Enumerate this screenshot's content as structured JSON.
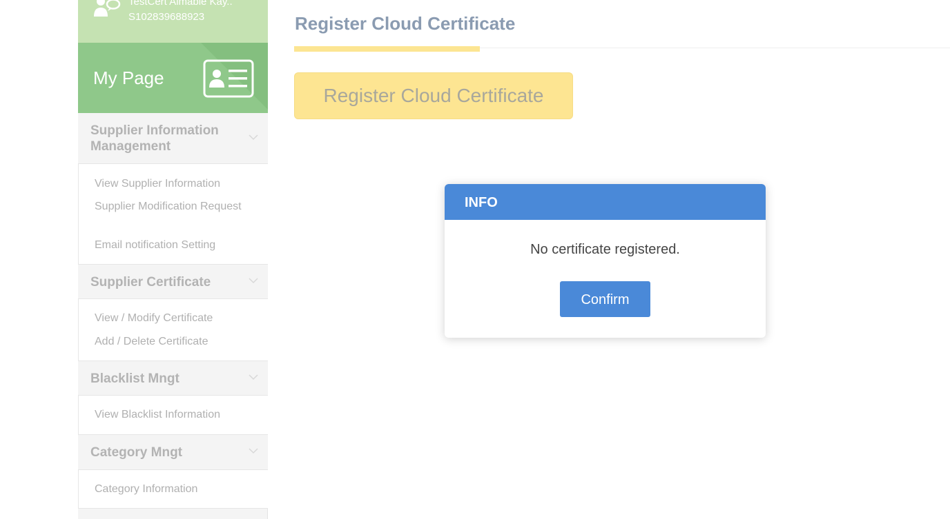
{
  "user": {
    "name": "TestCert Aimable Kay..",
    "id": "S102839688923"
  },
  "mypage": {
    "label": "My Page",
    "icon": "id-card-icon"
  },
  "sidebar": {
    "sections": [
      {
        "title": "Supplier Information Management",
        "items": [
          "View Supplier Information",
          "Supplier Modification Request",
          "Email notification Setting"
        ]
      },
      {
        "title": "Supplier Certificate",
        "items": [
          "View / Modify Certificate",
          "Add / Delete Certificate"
        ]
      },
      {
        "title": "Blacklist Mngt",
        "items": [
          "View Blacklist Information"
        ]
      },
      {
        "title": "Category Mngt",
        "items": [
          "Category Information"
        ]
      }
    ]
  },
  "main": {
    "title": "Register Cloud Certificate",
    "register_button": "Register Cloud Certificate"
  },
  "modal": {
    "title": "INFO",
    "message": "No certificate registered.",
    "confirm_label": "Confirm"
  },
  "colors": {
    "sidebar_green": "#8fc88a",
    "user_green": "#c5e2b2",
    "accent_yellow": "#fde592",
    "modal_blue": "#4a89d8"
  }
}
